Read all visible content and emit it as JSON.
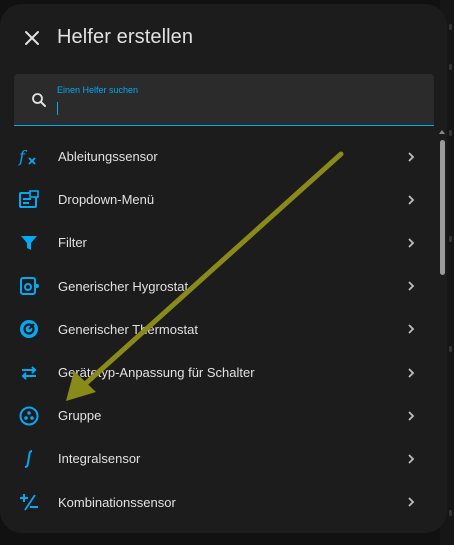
{
  "dialog": {
    "title": "Helfer erstellen",
    "close_icon": "close-icon"
  },
  "search": {
    "label": "Einen Helfer suchen",
    "value": "",
    "icon": "search-icon"
  },
  "items": [
    {
      "label": "Ableitungssensor",
      "icon": "function-icon"
    },
    {
      "label": "Dropdown-Menü",
      "icon": "dropdown-form-icon"
    },
    {
      "label": "Filter",
      "icon": "filter-icon"
    },
    {
      "label": "Generischer Hygrostat",
      "icon": "hygrostat-icon"
    },
    {
      "label": "Generischer Thermostat",
      "icon": "thermostat-icon"
    },
    {
      "label": "Gerätetyp-Anpassung für Schalter",
      "icon": "swap-arrows-icon"
    },
    {
      "label": "Gruppe",
      "icon": "group-icon"
    },
    {
      "label": "Integralsensor",
      "icon": "integral-icon"
    },
    {
      "label": "Kombinationssensor",
      "icon": "plus-minus-icon"
    }
  ],
  "colors": {
    "accent": "#03a9f4",
    "background": "#1c1c1c",
    "annotation_arrow": "#8a8a1a"
  }
}
